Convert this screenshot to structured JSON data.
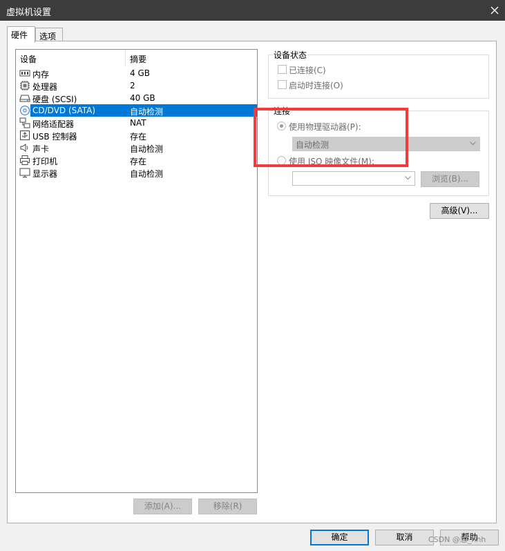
{
  "window": {
    "title": "虚拟机设置"
  },
  "tabs": [
    {
      "label": "硬件",
      "active": true
    },
    {
      "label": "选项",
      "active": false
    }
  ],
  "device_list": {
    "columns": [
      "设备",
      "摘要"
    ],
    "rows": [
      {
        "icon": "memory-icon",
        "name": "内存",
        "summary": "4 GB"
      },
      {
        "icon": "processor-icon",
        "name": "处理器",
        "summary": "2"
      },
      {
        "icon": "hard-disk-icon",
        "name": "硬盘 (SCSI)",
        "summary": "40 GB"
      },
      {
        "icon": "cd-dvd-icon",
        "name": "CD/DVD (SATA)",
        "summary": "自动检测",
        "selected": true
      },
      {
        "icon": "network-adapter-icon",
        "name": "网络适配器",
        "summary": "NAT"
      },
      {
        "icon": "usb-controller-icon",
        "name": "USB 控制器",
        "summary": "存在"
      },
      {
        "icon": "sound-card-icon",
        "name": "声卡",
        "summary": "自动检测"
      },
      {
        "icon": "printer-icon",
        "name": "打印机",
        "summary": "存在"
      },
      {
        "icon": "display-icon",
        "name": "显示器",
        "summary": "自动检测"
      }
    ],
    "add_label": "添加(A)...",
    "remove_label": "移除(R)"
  },
  "device_status": {
    "title": "设备状态",
    "connected_label": "已连接(C)",
    "connect_at_power_on_label": "启动时连接(O)"
  },
  "connection": {
    "title": "连接",
    "physical_drive_label": "使用物理驱动器(P):",
    "physical_drive_value": "自动检测",
    "iso_label": "使用 ISO 映像文件(M):",
    "iso_value": "",
    "browse_label": "浏览(B)..."
  },
  "advanced_label": "高级(V)...",
  "footer": {
    "ok_label": "确定",
    "cancel_label": "取消",
    "help_label": "帮助"
  },
  "watermark": "CSDN @想_hhh",
  "colors": {
    "selection": "#0078d7",
    "highlight_box": "#f03c3c",
    "titlebar": "#3c3c3c"
  }
}
